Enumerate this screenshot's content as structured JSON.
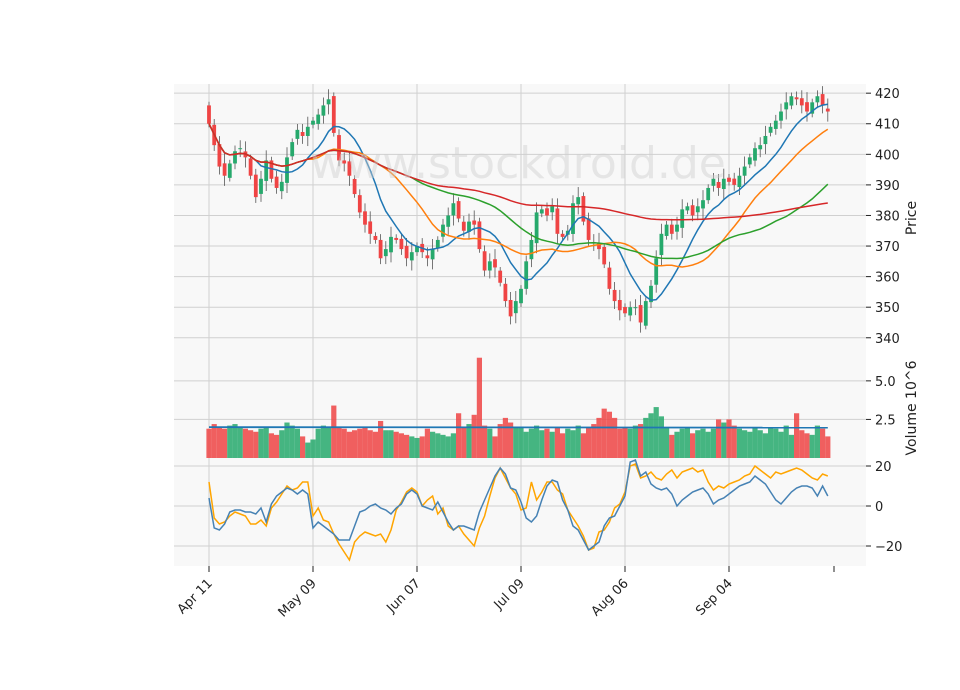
{
  "watermark": "www.stockdroid.de",
  "colors": {
    "up": "#26a96c",
    "down": "#ef4444",
    "ma_short": "#1f77b4",
    "ma_mid": "#ff7f0e",
    "ma_long": "#2ca02c",
    "ma_longest": "#d62728",
    "osc_a": "#4682b4",
    "osc_b": "#ffa500",
    "grid": "#d0d0d0",
    "panel_bg": "#f8f8f8"
  },
  "chart_data": [
    {
      "panel": "price",
      "type": "candlestick",
      "ylabel": "Price",
      "ylim": [
        336,
        423
      ],
      "yticks": [
        340,
        350,
        360,
        370,
        380,
        390,
        400,
        410,
        420
      ],
      "xtick_labels": [
        "Apr 11",
        "May 09",
        "Jun 07",
        "Jul 09",
        "Aug 06",
        "Sep 04"
      ],
      "xtick_index": [
        0,
        20,
        40,
        60,
        80,
        100
      ],
      "grid": true,
      "closes": [
        410,
        403,
        396,
        393,
        397,
        401,
        402,
        399,
        393,
        386,
        392,
        398,
        392,
        389,
        391,
        399,
        404,
        408,
        406,
        409,
        411,
        413,
        416,
        418,
        407,
        398,
        397,
        393,
        387,
        381,
        377,
        374,
        372,
        366,
        369,
        373,
        372,
        369,
        366,
        368,
        370,
        368,
        366,
        369,
        372,
        377,
        380,
        384,
        379,
        375,
        378,
        377,
        369,
        362,
        365,
        363,
        358,
        352,
        347,
        352,
        356,
        365,
        372,
        381,
        382,
        380,
        383,
        374,
        373,
        375,
        384,
        386,
        378,
        372,
        371,
        369,
        364,
        356,
        352,
        349,
        348,
        350,
        350,
        345,
        352,
        357,
        366,
        374,
        377,
        374,
        377,
        382,
        383,
        380,
        383,
        385,
        389,
        392,
        389,
        392,
        391,
        390,
        393,
        396,
        399,
        402,
        403,
        406,
        409,
        411,
        414,
        417,
        419,
        418,
        416,
        414,
        417,
        419,
        416,
        414
      ]
    },
    {
      "panel": "volume",
      "type": "bar",
      "ylabel": "Volume  10^6",
      "ylim": [
        0,
        7
      ],
      "yticks": [
        2.5,
        5.0
      ],
      "ma_value": 2.0,
      "values": [
        1.9,
        2.2,
        2.0,
        1.9,
        2.1,
        2.2,
        2.0,
        1.9,
        1.8,
        1.7,
        1.9,
        2.0,
        1.6,
        1.5,
        1.8,
        2.3,
        2.1,
        1.9,
        1.4,
        1.0,
        1.2,
        1.9,
        2.1,
        2.0,
        3.4,
        2.0,
        1.9,
        1.7,
        1.8,
        1.9,
        2.0,
        1.8,
        1.7,
        2.4,
        1.8,
        1.8,
        1.7,
        1.6,
        1.5,
        1.4,
        1.3,
        1.4,
        1.9,
        1.7,
        1.6,
        1.5,
        1.4,
        1.6,
        2.9,
        2.0,
        2.2,
        2.8,
        6.5,
        2.1,
        1.9,
        1.4,
        2.2,
        2.6,
        2.3,
        2.0,
        2.0,
        1.7,
        1.9,
        2.1,
        1.8,
        1.9,
        1.7,
        2.0,
        1.6,
        1.9,
        1.8,
        2.1,
        1.6,
        2.0,
        2.2,
        2.6,
        3.2,
        3.0,
        2.6,
        1.9,
        2.0,
        1.9,
        2.1,
        2.2,
        2.6,
        2.9,
        3.3,
        2.7,
        2.0,
        1.5,
        1.7,
        1.9,
        2.0,
        1.6,
        1.8,
        1.9,
        1.7,
        1.9,
        2.5,
        2.3,
        2.5,
        2.1,
        1.9,
        1.8,
        1.7,
        2.0,
        1.8,
        1.6,
        2.0,
        1.9,
        1.7,
        2.1,
        1.5,
        2.9,
        1.8,
        1.6,
        1.5,
        2.1,
        1.9,
        1.4
      ]
    },
    {
      "panel": "oscillator",
      "type": "line",
      "ylim": [
        -30,
        24
      ],
      "yticks": [
        -20,
        0,
        20
      ],
      "series": [
        {
          "values": [
            4,
            -11,
            -12,
            -9,
            -3,
            -2,
            -2,
            -3,
            -3,
            -4,
            -1,
            -8,
            1,
            5,
            7,
            9,
            8,
            6,
            8,
            6,
            -11,
            -8,
            -10,
            -12,
            -14,
            -17,
            -17,
            -17,
            -10,
            -3,
            -2,
            0,
            1,
            -1,
            -2,
            -4,
            -1,
            1,
            6,
            8,
            6,
            0,
            -1,
            -2,
            2,
            -3,
            -8,
            -12,
            -10,
            -10,
            -11,
            -12,
            -3,
            3,
            9,
            15,
            19,
            16,
            9,
            8,
            2,
            -6,
            -8,
            -5,
            3,
            10,
            13,
            12,
            3,
            -2,
            -10,
            -12,
            -17,
            -22,
            -20,
            -18,
            -10,
            -6,
            -5,
            0,
            5,
            22,
            23,
            15,
            17,
            11,
            9,
            8,
            9,
            6,
            0,
            3,
            5,
            7,
            8,
            9,
            6,
            1,
            3,
            4,
            6,
            8,
            10,
            11,
            12,
            15,
            13,
            11,
            7,
            3,
            1,
            4,
            7,
            9,
            10,
            10,
            9,
            5,
            10,
            5
          ]
        },
        {
          "values": [
            12,
            -6,
            -9,
            -8,
            -5,
            -3,
            -4,
            -5,
            -9,
            -9,
            -7,
            -10,
            -1,
            2,
            6,
            10,
            8,
            9,
            12,
            12,
            -5,
            -1,
            -7,
            -8,
            -14,
            -19,
            -23,
            -27,
            -18,
            -15,
            -13,
            -14,
            -15,
            -14,
            -18,
            -12,
            -2,
            2,
            7,
            9,
            7,
            0,
            3,
            5,
            -4,
            -1,
            -10,
            -12,
            -10,
            -14,
            -17,
            -20,
            -11,
            -5,
            5,
            14,
            19,
            14,
            9,
            6,
            -2,
            -1,
            12,
            3,
            7,
            12,
            12,
            8,
            6,
            -2,
            -6,
            -10,
            -15,
            -22,
            -21,
            -13,
            -12,
            -8,
            -1,
            1,
            7,
            20,
            21,
            14,
            15,
            17,
            14,
            13,
            16,
            18,
            14,
            17,
            18,
            19,
            17,
            18,
            12,
            8,
            10,
            9,
            11,
            12,
            13,
            15,
            16,
            20,
            18,
            16,
            14,
            17,
            16,
            17,
            18,
            19,
            18,
            16,
            14,
            13,
            16,
            15
          ]
        }
      ]
    }
  ]
}
